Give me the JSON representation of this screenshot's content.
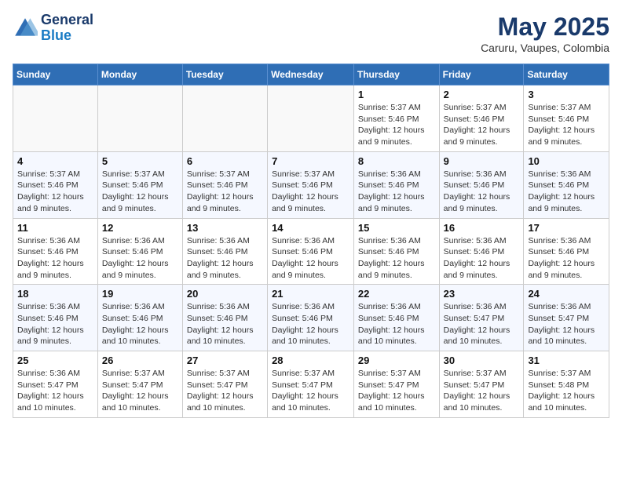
{
  "header": {
    "logo_line1": "General",
    "logo_line2": "Blue",
    "title": "May 2025",
    "subtitle": "Caruru, Vaupes, Colombia"
  },
  "days_of_week": [
    "Sunday",
    "Monday",
    "Tuesday",
    "Wednesday",
    "Thursday",
    "Friday",
    "Saturday"
  ],
  "weeks": [
    [
      {
        "day": "",
        "info": ""
      },
      {
        "day": "",
        "info": ""
      },
      {
        "day": "",
        "info": ""
      },
      {
        "day": "",
        "info": ""
      },
      {
        "day": "1",
        "info": "Sunrise: 5:37 AM\nSunset: 5:46 PM\nDaylight: 12 hours\nand 9 minutes."
      },
      {
        "day": "2",
        "info": "Sunrise: 5:37 AM\nSunset: 5:46 PM\nDaylight: 12 hours\nand 9 minutes."
      },
      {
        "day": "3",
        "info": "Sunrise: 5:37 AM\nSunset: 5:46 PM\nDaylight: 12 hours\nand 9 minutes."
      }
    ],
    [
      {
        "day": "4",
        "info": "Sunrise: 5:37 AM\nSunset: 5:46 PM\nDaylight: 12 hours\nand 9 minutes."
      },
      {
        "day": "5",
        "info": "Sunrise: 5:37 AM\nSunset: 5:46 PM\nDaylight: 12 hours\nand 9 minutes."
      },
      {
        "day": "6",
        "info": "Sunrise: 5:37 AM\nSunset: 5:46 PM\nDaylight: 12 hours\nand 9 minutes."
      },
      {
        "day": "7",
        "info": "Sunrise: 5:37 AM\nSunset: 5:46 PM\nDaylight: 12 hours\nand 9 minutes."
      },
      {
        "day": "8",
        "info": "Sunrise: 5:36 AM\nSunset: 5:46 PM\nDaylight: 12 hours\nand 9 minutes."
      },
      {
        "day": "9",
        "info": "Sunrise: 5:36 AM\nSunset: 5:46 PM\nDaylight: 12 hours\nand 9 minutes."
      },
      {
        "day": "10",
        "info": "Sunrise: 5:36 AM\nSunset: 5:46 PM\nDaylight: 12 hours\nand 9 minutes."
      }
    ],
    [
      {
        "day": "11",
        "info": "Sunrise: 5:36 AM\nSunset: 5:46 PM\nDaylight: 12 hours\nand 9 minutes."
      },
      {
        "day": "12",
        "info": "Sunrise: 5:36 AM\nSunset: 5:46 PM\nDaylight: 12 hours\nand 9 minutes."
      },
      {
        "day": "13",
        "info": "Sunrise: 5:36 AM\nSunset: 5:46 PM\nDaylight: 12 hours\nand 9 minutes."
      },
      {
        "day": "14",
        "info": "Sunrise: 5:36 AM\nSunset: 5:46 PM\nDaylight: 12 hours\nand 9 minutes."
      },
      {
        "day": "15",
        "info": "Sunrise: 5:36 AM\nSunset: 5:46 PM\nDaylight: 12 hours\nand 9 minutes."
      },
      {
        "day": "16",
        "info": "Sunrise: 5:36 AM\nSunset: 5:46 PM\nDaylight: 12 hours\nand 9 minutes."
      },
      {
        "day": "17",
        "info": "Sunrise: 5:36 AM\nSunset: 5:46 PM\nDaylight: 12 hours\nand 9 minutes."
      }
    ],
    [
      {
        "day": "18",
        "info": "Sunrise: 5:36 AM\nSunset: 5:46 PM\nDaylight: 12 hours\nand 9 minutes."
      },
      {
        "day": "19",
        "info": "Sunrise: 5:36 AM\nSunset: 5:46 PM\nDaylight: 12 hours\nand 10 minutes."
      },
      {
        "day": "20",
        "info": "Sunrise: 5:36 AM\nSunset: 5:46 PM\nDaylight: 12 hours\nand 10 minutes."
      },
      {
        "day": "21",
        "info": "Sunrise: 5:36 AM\nSunset: 5:46 PM\nDaylight: 12 hours\nand 10 minutes."
      },
      {
        "day": "22",
        "info": "Sunrise: 5:36 AM\nSunset: 5:46 PM\nDaylight: 12 hours\nand 10 minutes."
      },
      {
        "day": "23",
        "info": "Sunrise: 5:36 AM\nSunset: 5:47 PM\nDaylight: 12 hours\nand 10 minutes."
      },
      {
        "day": "24",
        "info": "Sunrise: 5:36 AM\nSunset: 5:47 PM\nDaylight: 12 hours\nand 10 minutes."
      }
    ],
    [
      {
        "day": "25",
        "info": "Sunrise: 5:36 AM\nSunset: 5:47 PM\nDaylight: 12 hours\nand 10 minutes."
      },
      {
        "day": "26",
        "info": "Sunrise: 5:37 AM\nSunset: 5:47 PM\nDaylight: 12 hours\nand 10 minutes."
      },
      {
        "day": "27",
        "info": "Sunrise: 5:37 AM\nSunset: 5:47 PM\nDaylight: 12 hours\nand 10 minutes."
      },
      {
        "day": "28",
        "info": "Sunrise: 5:37 AM\nSunset: 5:47 PM\nDaylight: 12 hours\nand 10 minutes."
      },
      {
        "day": "29",
        "info": "Sunrise: 5:37 AM\nSunset: 5:47 PM\nDaylight: 12 hours\nand 10 minutes."
      },
      {
        "day": "30",
        "info": "Sunrise: 5:37 AM\nSunset: 5:47 PM\nDaylight: 12 hours\nand 10 minutes."
      },
      {
        "day": "31",
        "info": "Sunrise: 5:37 AM\nSunset: 5:48 PM\nDaylight: 12 hours\nand 10 minutes."
      }
    ]
  ]
}
